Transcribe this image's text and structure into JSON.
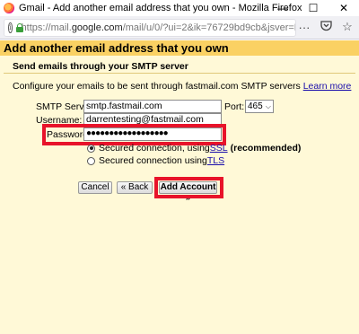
{
  "window": {
    "title": "Gmail - Add another email address that you own - Mozilla Firefox",
    "controls": {
      "minimize": "—",
      "maximize": "☐",
      "close": "✕"
    }
  },
  "browser": {
    "url_prefix": "https://mail.",
    "url_domain": "google.com",
    "url_rest": "/mail/u/0/?ui=2&ik=76729bd9cb&jsver=D2Wa",
    "url_overflow": "···",
    "icons": [
      "info-icon",
      "lock-icon",
      "page-actions-icon",
      "pocket-icon",
      "bookmark-star-icon"
    ]
  },
  "dialog": {
    "header": "Add another email address that you own",
    "section_title": "Send emails through your SMTP server",
    "description": "Configure your emails to be sent through fastmail.com SMTP servers",
    "learn_more": "Learn more",
    "smtp_label": "SMTP Server:",
    "smtp_value": "smtp.fastmail.com",
    "port_label": "Port:",
    "port_value": "465",
    "username_label": "Username:",
    "username_value": "darrentesting@fastmail.com",
    "password_label": "Password:",
    "password_value": "●●●●●●●●●●●●●●●●●●",
    "ssl_option_prefix": "Secured connection, using ",
    "ssl_link": "SSL",
    "ssl_recommended": "(recommended)",
    "tls_option_prefix": "Secured connection using ",
    "tls_link": "TLS",
    "selected_security": "SSL",
    "cancel_label": "Cancel",
    "back_label": "« Back",
    "add_account_label": "Add Account »"
  },
  "colors": {
    "page_bg": "#fff9d7",
    "header_bg": "#fad163",
    "highlight": "#e8132a",
    "link": "#1a0dab"
  }
}
